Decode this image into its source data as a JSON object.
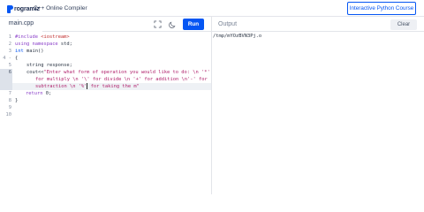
{
  "header": {
    "logo_text": "rogramiz",
    "title": "C++ Online Compiler",
    "course_button": "Interactive Python Course"
  },
  "toolbar": {
    "file_tab": "main.cpp",
    "run_label": "Run",
    "output_label": "Output",
    "clear_label": "Clear"
  },
  "editor": {
    "line_numbers": [
      "1",
      "2",
      "3",
      "4 -",
      "5",
      "6",
      "7",
      "8",
      "9",
      "10"
    ],
    "lines": {
      "l1_pp": "#include ",
      "l1_inc": "<iostream>",
      "l2_kw": "using namespace",
      "l2_rest": " std;",
      "l3_kw": "int",
      "l3_rest": " main()",
      "l4": "{",
      "l5": "    string response;",
      "l6_pre": "    cout<<",
      "l6_str": "\"Enter what form of operation you would like to do: \\n '*'",
      "l6w2": "for multiply \\n '\\' for divide \\n '+' for addition \\n'-' for",
      "l6w3_a": "subtraction \\n '%'",
      "l6w3_b": " for taking the m\"",
      "l7_kw": "return",
      "l7_rest": " 0;",
      "l8": "}"
    }
  },
  "output": {
    "text": "/tmp/mYOzBVN3Pj.o"
  },
  "colors": {
    "accent": "#0556f3",
    "keyword": "#8a3fc9",
    "string": "#b0206b"
  },
  "icons": [
    "fullscreen-icon",
    "moon-icon",
    "programiz-logo"
  ]
}
